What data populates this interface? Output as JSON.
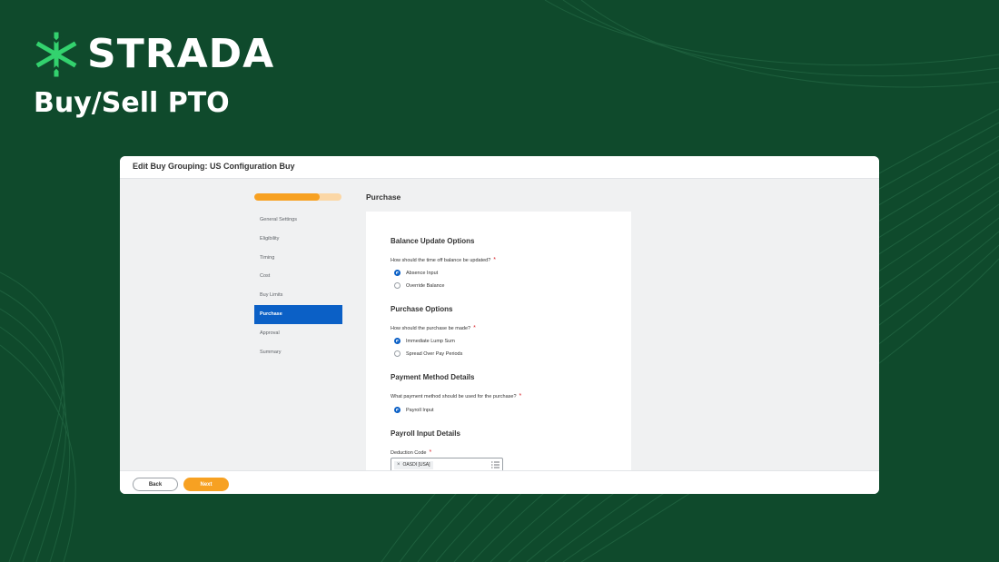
{
  "brand": {
    "name": "STRADA",
    "logo_icon": "snowflake-asterisk-icon",
    "accent": "#33d26e"
  },
  "slide": {
    "title": "Buy/Sell PTO"
  },
  "window": {
    "title": "Edit Buy Grouping: US Configuration Buy",
    "progress_fraction": 0.75,
    "steps": [
      {
        "label": "General Settings",
        "active": false
      },
      {
        "label": "Eligibility",
        "active": false
      },
      {
        "label": "Timing",
        "active": false
      },
      {
        "label": "Cost",
        "active": false
      },
      {
        "label": "Buy Limits",
        "active": false
      },
      {
        "label": "Purchase",
        "active": true
      },
      {
        "label": "Approval",
        "active": false
      },
      {
        "label": "Summary",
        "active": false
      }
    ],
    "section_title": "Purchase",
    "form": {
      "balance_heading": "Balance Update Options",
      "balance_question": "How should the time off balance be updated?",
      "balance_options": [
        "Absence Input",
        "Override Balance"
      ],
      "purchase_heading": "Purchase Options",
      "purchase_question": "How should the purchase be made?",
      "purchase_options": [
        "Immediate Lump Sum",
        "Spread Over Pay Periods"
      ],
      "payment_heading": "Payment Method Details",
      "payment_question": "What payment method should be used for the purchase?",
      "payment_options": [
        "Payroll Input"
      ],
      "payroll_heading": "Payroll Input Details",
      "deduction_label": "Deduction Code",
      "deduction_value": "OASDI [USA]",
      "required_marker": "*"
    },
    "footer": {
      "back_label": "Back",
      "next_label": "Next"
    }
  }
}
